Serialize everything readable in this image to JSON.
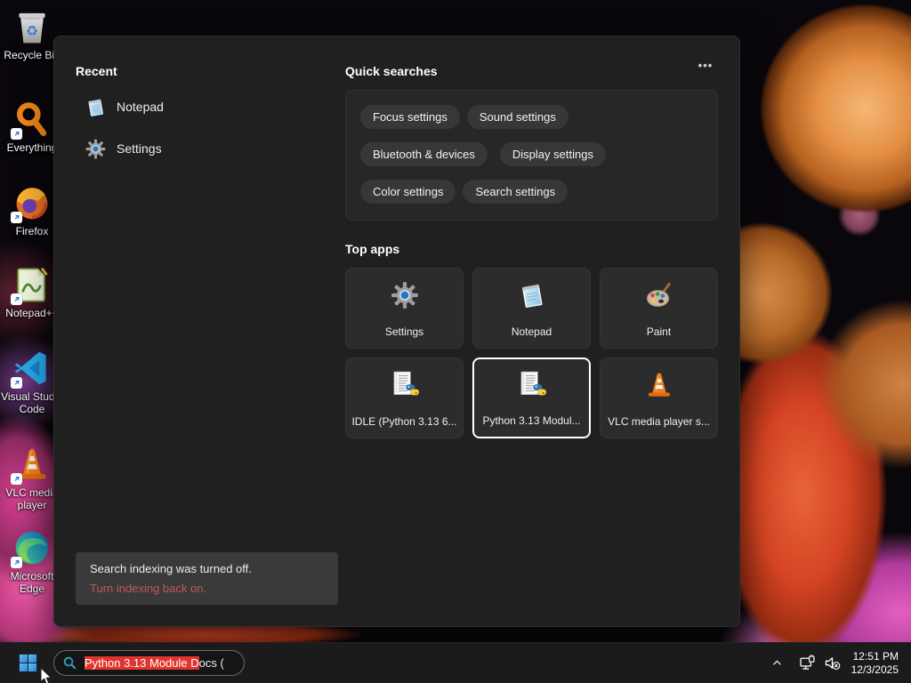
{
  "colors": {
    "selection_red": "#e0342c",
    "notice_link": "#c05a50",
    "tile_selected_border": "#ffffff",
    "panel_bg": "#202020",
    "pill_bg": "#373737",
    "taskbar_bg": "#1b1b1c"
  },
  "desktop": {
    "icons": [
      {
        "label": "Recycle Bin"
      },
      {
        "label": "Everything"
      },
      {
        "label": "Firefox"
      },
      {
        "label": "Notepad++"
      },
      {
        "label": "Visual Studio Code"
      },
      {
        "label": "VLC media player"
      },
      {
        "label": "Microsoft Edge"
      }
    ]
  },
  "panel": {
    "recent": {
      "header": "Recent",
      "items": [
        {
          "label": "Notepad",
          "icon": "notepad-icon"
        },
        {
          "label": "Settings",
          "icon": "gear-icon"
        }
      ]
    },
    "quick": {
      "header": "Quick searches",
      "more_label": "•••",
      "rows": [
        [
          "Focus settings",
          "Sound settings"
        ],
        [
          "Bluetooth & devices",
          "Display settings"
        ],
        [
          "Color settings",
          "Search settings"
        ]
      ]
    },
    "top_apps": {
      "header": "Top apps",
      "tiles": [
        {
          "label": "Settings",
          "icon": "gear-icon",
          "selected": false
        },
        {
          "label": "Notepad",
          "icon": "notepad-icon",
          "selected": false
        },
        {
          "label": "Paint",
          "icon": "paint-icon",
          "selected": false
        },
        {
          "label": "IDLE (Python 3.13 6...",
          "icon": "python-doc-icon",
          "selected": false
        },
        {
          "label": "Python 3.13 Modul...",
          "icon": "python-doc-icon",
          "selected": true
        },
        {
          "label": "VLC media player s...",
          "icon": "vlc-cone-icon",
          "selected": false
        }
      ]
    },
    "notice": {
      "message": "Search indexing was turned off.",
      "action": "Turn indexing back on."
    }
  },
  "taskbar": {
    "search": {
      "selected_text": "Python 3.13 Module D",
      "tail_text": "ocs ("
    },
    "clock": {
      "time": "12:51 PM",
      "date": "12/3/2025"
    }
  }
}
